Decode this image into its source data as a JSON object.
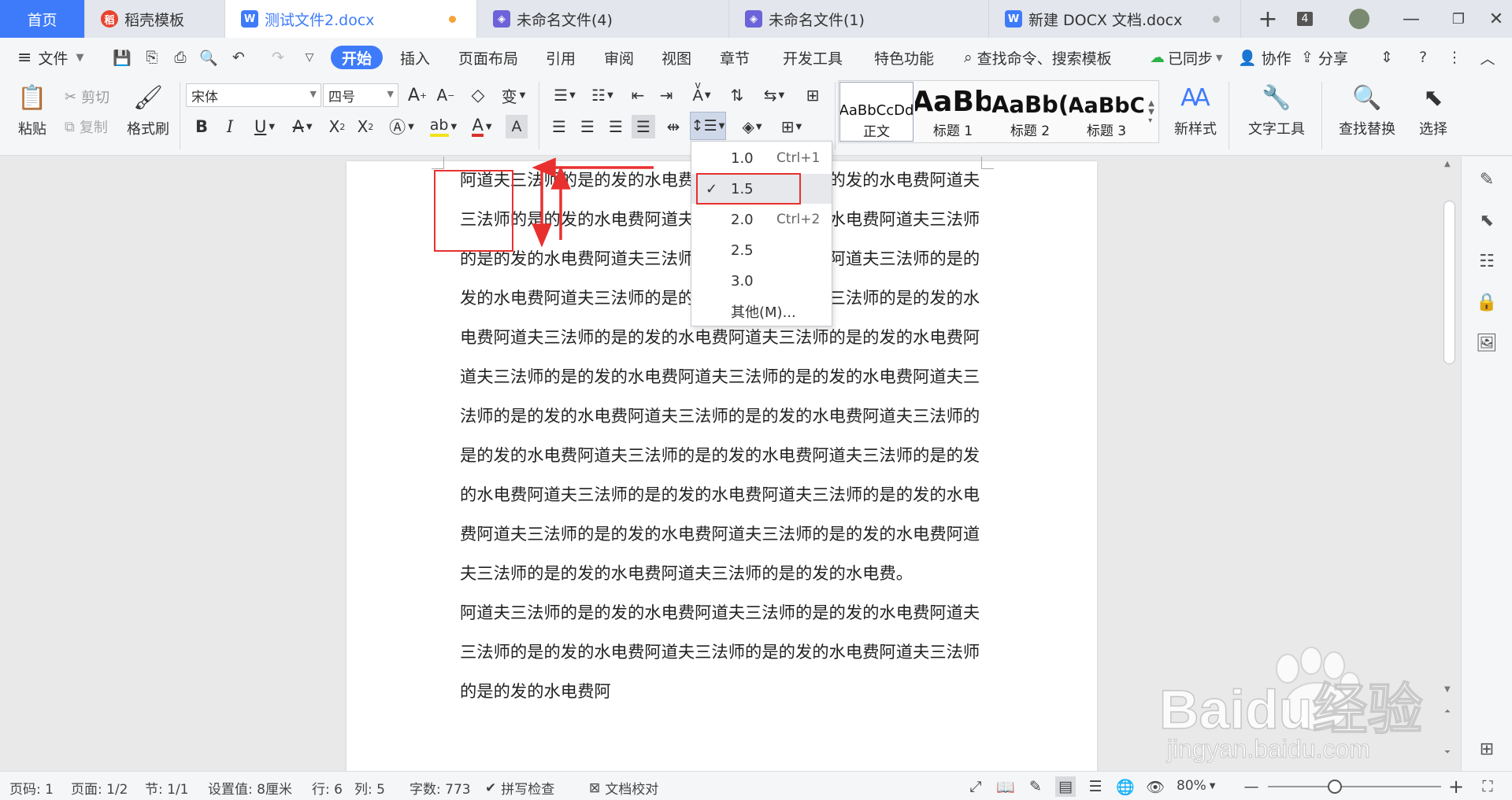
{
  "tabs": {
    "home": "首页",
    "template": "稻壳模板",
    "doc_active": "测试文件2.docx",
    "unnamed4": "未命名文件(4)",
    "unnamed1": "未命名文件(1)",
    "new_docx": "新建 DOCX 文档.docx",
    "add": "+",
    "window_count": "4"
  },
  "menu": {
    "file": "文件",
    "start": "开始",
    "insert": "插入",
    "layout": "页面布局",
    "reference": "引用",
    "review": "审阅",
    "view": "视图",
    "chapter": "章节",
    "devtools": "开发工具",
    "special": "特色功能",
    "search_cmd": "查找命令、搜索模板",
    "synced": "已同步",
    "collab": "协作",
    "share": "分享"
  },
  "ribbon": {
    "paste": "粘贴",
    "cut": "剪切",
    "copy": "复制",
    "format_painter": "格式刷",
    "font_name": "宋体",
    "font_size": "四号",
    "styles": [
      {
        "preview": "AaBbCcDd",
        "label": "正文"
      },
      {
        "preview": "AaBb",
        "label": "标题 1"
      },
      {
        "preview": "AaBb(",
        "label": "标题 2"
      },
      {
        "preview": "AaBbC",
        "label": "标题 3"
      }
    ],
    "new_style": "新样式",
    "text_tools": "文字工具",
    "find_replace": "查找替换",
    "select": "选择"
  },
  "line_spacing_menu": {
    "items": [
      {
        "value": "1.0",
        "shortcut": "Ctrl+1"
      },
      {
        "value": "1.5",
        "shortcut": ""
      },
      {
        "value": "2.0",
        "shortcut": "Ctrl+2"
      },
      {
        "value": "2.5",
        "shortcut": ""
      },
      {
        "value": "3.0",
        "shortcut": ""
      },
      {
        "value": "其他(M)...",
        "shortcut": ""
      }
    ],
    "selected": "1.5"
  },
  "document": {
    "paragraph1": "阿道夫三法师的是的发的水电费阿道夫三法师的是的发的水电费阿道夫三法师的是的发的水电费阿道夫三法师的是的发的水电费阿道夫三法师的是的发的水电费阿道夫三法师的是的发的水电费阿道夫三法师的是的发的水电费阿道夫三法师的是的发的水电费阿道夫三法师的是的发的水电费阿道夫三法师的是的发的水电费阿道夫三法师的是的发的水电费阿道夫三法师的是的发的水电费阿道夫三法师的是的发的水电费阿道夫三法师的是的发的水电费阿道夫三法师的是的发的水电费阿道夫三法师的是的发的水电费阿道夫三法师的是的发的水电费阿道夫三法师的是的发的水电费阿道夫三法师的是的发的水电费阿道夫三法师的是的发的水电费阿道夫三法师的是的发的水电费阿道夫三法师的是的发的水电费阿道夫三法师的是的发的水电费阿道夫三法师的是的发的水电费。",
    "paragraph2": "阿道夫三法师的是的发的水电费阿道夫三法师的是的发的水电费阿道夫三法师的是的发的水电费阿道夫三法师的是的发的水电费阿道夫三法师的是的发的水电费阿"
  },
  "status": {
    "page_num": "页码: 1",
    "page": "页面: 1/2",
    "section": "节: 1/1",
    "setting": "设置值: 8厘米",
    "row": "行: 6",
    "col": "列: 5",
    "word_count": "字数: 773",
    "spell_check": "拼写检查",
    "doc_proof": "文档校对",
    "zoom": "80%"
  },
  "watermark": {
    "brand": "Baidu经验",
    "url": "jingyan.baidu.com"
  },
  "colors": {
    "accent": "#3e7bfa",
    "annotation_red": "#e8312f",
    "wps_red": "#d9302b"
  }
}
